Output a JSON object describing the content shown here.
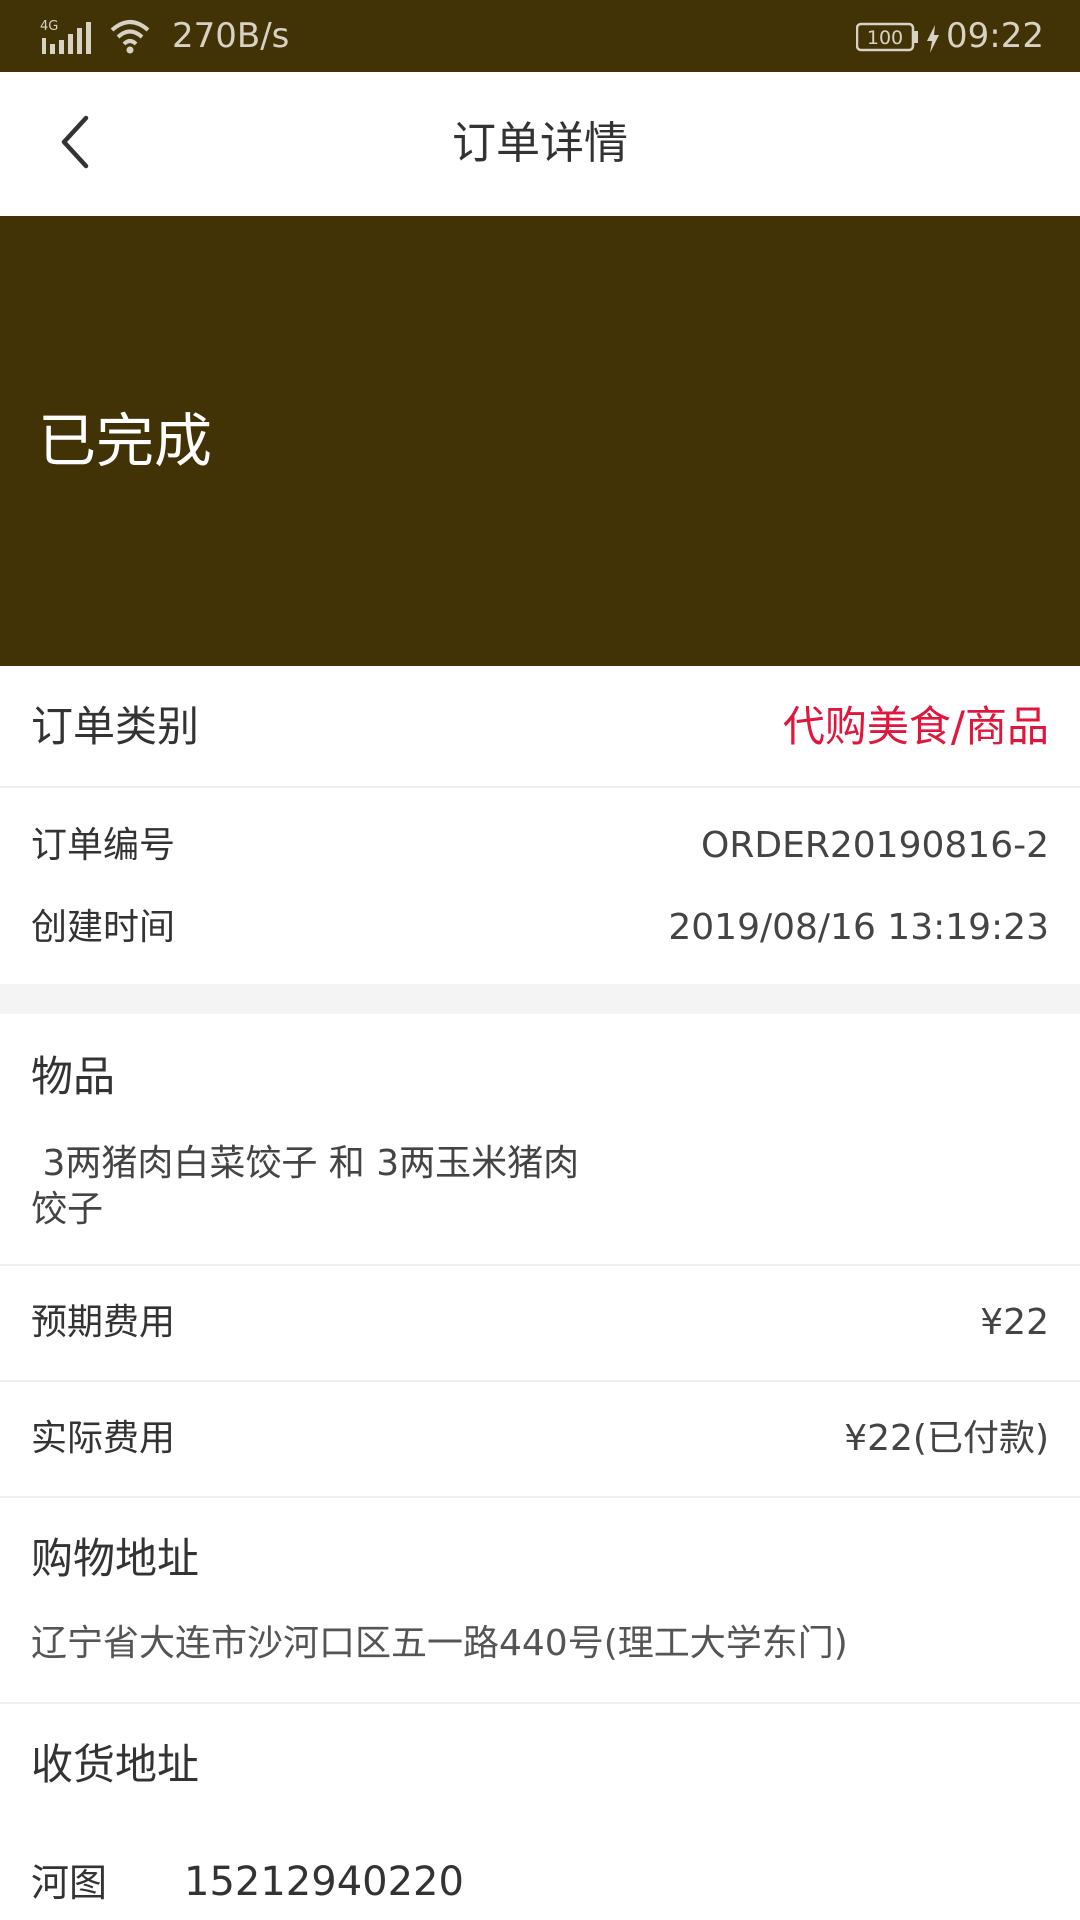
{
  "status_bar": {
    "network_speed": "270B/s",
    "battery": "100",
    "time": "09:22"
  },
  "header": {
    "title": "订单详情"
  },
  "banner": {
    "status": "已完成"
  },
  "order": {
    "type_label": "订单类别",
    "type_value": "代购美食/商品",
    "number_label": "订单编号",
    "number_value": "ORDER20190816-2",
    "created_label": "创建时间",
    "created_value": "2019/08/16 13:19:23"
  },
  "items": {
    "label": "物品",
    "line1": " 3两猪肉白菜饺子 和 3两玉米猪肉",
    "line2": "饺子"
  },
  "fees": {
    "expected_label": "预期费用",
    "expected_value": "¥22",
    "actual_label": "实际费用",
    "actual_value": "¥22(已付款)"
  },
  "shopping_address": {
    "label": "购物地址",
    "value": "辽宁省大连市沙河口区五一路440号(理工大学东门)"
  },
  "delivery_address": {
    "label": "收货地址",
    "name": "河图",
    "phone": "15212940220"
  },
  "colors": {
    "brand": "#423307",
    "accent": "#e0163d"
  }
}
